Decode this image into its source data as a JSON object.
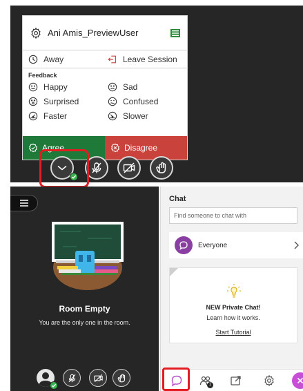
{
  "status_menu": {
    "username": "Ani Amis_PreviewUser",
    "away_label": "Away",
    "leave_label": "Leave Session",
    "feedback_heading": "Feedback",
    "feedback": [
      [
        "Happy",
        "Sad"
      ],
      [
        "Surprised",
        "Confused"
      ],
      [
        "Faster",
        "Slower"
      ]
    ],
    "agree_label": "Agree",
    "disagree_label": "Disagree"
  },
  "session": {
    "room_title": "Room Empty",
    "room_subtitle": "You are the only one in the room."
  },
  "chat": {
    "title": "Chat",
    "search_placeholder": "Find someone to chat with",
    "everyone_label": "Everyone",
    "card_title": "NEW Private Chat!",
    "card_subtitle": "Learn how it works.",
    "card_link": "Start Tutorial",
    "attendees_badge": "1"
  },
  "icons": {
    "settings": "gear-icon",
    "list": "list-icon",
    "away": "clock-icon",
    "leave": "exit-icon",
    "status": "chevron-down-icon",
    "mic": "mic-off-icon",
    "camera": "camera-off-icon",
    "hand": "raise-hand-icon",
    "chat": "chat-bubble-icon",
    "attendees": "attendees-icon",
    "share": "share-content-icon",
    "close": "close-icon"
  },
  "colors": {
    "agree": "#1f7a3a",
    "disagree": "#c9423c",
    "available": "#37b24d",
    "highlight": "#e31b23",
    "chat_accent": "#8b3fa3",
    "close_button": "#c64fd6",
    "dark_bg": "#262626"
  }
}
